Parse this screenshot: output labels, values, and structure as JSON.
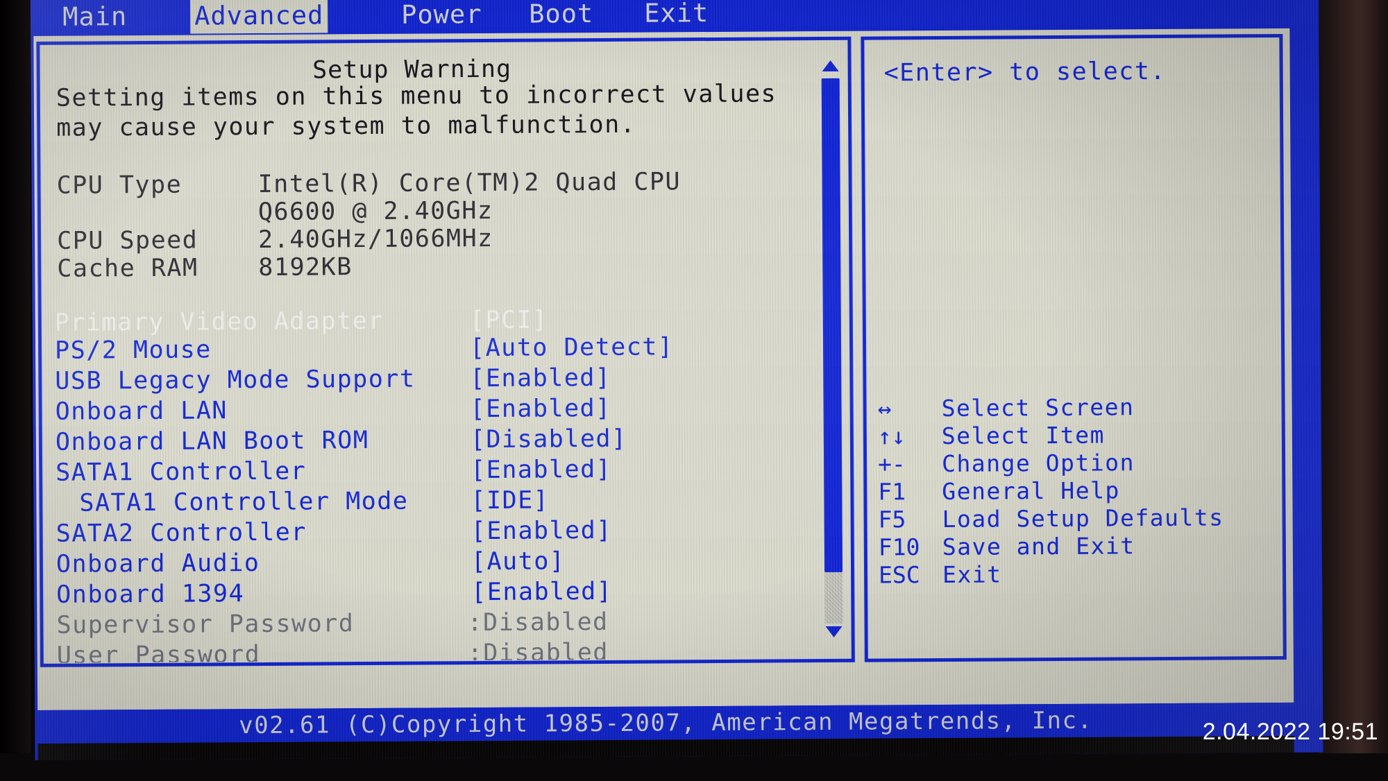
{
  "colors": {
    "screen_blue": "#1226d8",
    "panel_bg": "#dcdccf",
    "text_black": "#15151c",
    "text_grey": "#6f737e",
    "text_white": "#f2f2ef"
  },
  "menubar": {
    "tabs": [
      {
        "label": "Main",
        "selected": false
      },
      {
        "label": "Advanced",
        "selected": true
      },
      {
        "label": "Power",
        "selected": false
      },
      {
        "label": "Boot",
        "selected": false
      },
      {
        "label": "Exit",
        "selected": false
      }
    ]
  },
  "main": {
    "warning_title": "Setup Warning",
    "warning_line1": "Setting items on this menu to incorrect values",
    "warning_line2": "may cause your system to malfunction.",
    "info_rows": [
      {
        "label": "CPU Type",
        "value": "Intel(R) Core(TM)2 Quad CPU"
      },
      {
        "label": "",
        "value": "Q6600  @ 2.40GHz"
      },
      {
        "label": "CPU Speed",
        "value": "2.40GHz/1066MHz"
      },
      {
        "label": "Cache RAM",
        "value": "8192KB"
      }
    ],
    "option_rows": [
      {
        "label": "Primary Video Adapter",
        "value": "[PCI]",
        "state": "selected",
        "indent": false
      },
      {
        "label": "PS/2 Mouse",
        "value": "[Auto Detect]",
        "state": "normal",
        "indent": false
      },
      {
        "label": "USB Legacy Mode Support",
        "value": "[Enabled]",
        "state": "normal",
        "indent": false
      },
      {
        "label": "Onboard LAN",
        "value": "[Enabled]",
        "state": "normal",
        "indent": false
      },
      {
        "label": "Onboard LAN Boot ROM",
        "value": "[Disabled]",
        "state": "normal",
        "indent": false
      },
      {
        "label": "SATA1 Controller",
        "value": "[Enabled]",
        "state": "normal",
        "indent": false
      },
      {
        "label": "SATA1 Controller Mode",
        "value": "[IDE]",
        "state": "normal",
        "indent": true
      },
      {
        "label": "SATA2 Controller",
        "value": "[Enabled]",
        "state": "normal",
        "indent": false
      },
      {
        "label": "Onboard Audio",
        "value": "[Auto]",
        "state": "normal",
        "indent": false
      },
      {
        "label": "Onboard 1394",
        "value": "[Enabled]",
        "state": "normal",
        "indent": false
      },
      {
        "label": "Supervisor Password",
        "value": ":Disabled",
        "state": "dim",
        "indent": false
      },
      {
        "label": "User Password",
        "value": ":Disabled",
        "state": "dim",
        "indent": false
      }
    ],
    "scrollbar": {
      "up_arrow": "scroll-up-arrow",
      "down_arrow": "scroll-down-arrow",
      "thumb_percent": 90
    }
  },
  "help": {
    "text": "<Enter> to select.",
    "key_legend": [
      {
        "key": "↔",
        "desc": "Select Screen"
      },
      {
        "key": "↑↓",
        "desc": "Select Item"
      },
      {
        "key": "+-",
        "desc": "Change Option"
      },
      {
        "key": "F1",
        "desc": "General Help"
      },
      {
        "key": "F5",
        "desc": "Load Setup Defaults"
      },
      {
        "key": "F10",
        "desc": "Save and Exit"
      },
      {
        "key": "ESC",
        "desc": "Exit"
      }
    ]
  },
  "footer": {
    "text": "v02.61 (C)Copyright 1985-2007, American Megatrends, Inc."
  },
  "overlay": {
    "timestamp": "2.04.2022 19:51"
  }
}
